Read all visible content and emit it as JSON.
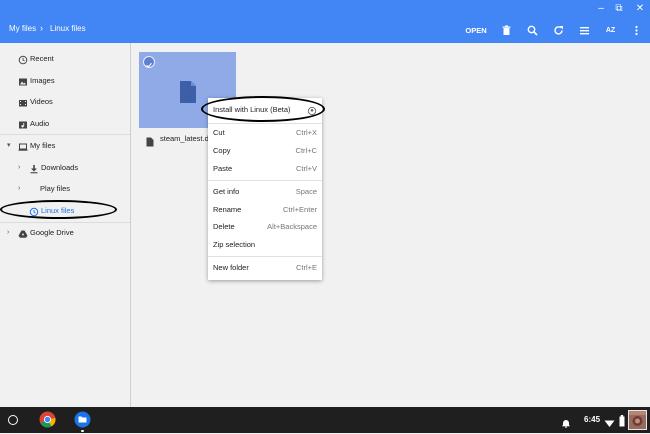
{
  "window": {
    "minimize_glyph": "–",
    "maximize_glyph": "⧉",
    "close_glyph": "✕"
  },
  "toolbar": {
    "breadcrumb": [
      "My files",
      "Linux files"
    ],
    "breadcrumb_separator": "›",
    "open_label": "OPEN",
    "icons": [
      "delete-icon",
      "search-icon",
      "refresh-icon",
      "list-view-icon",
      "sort-az-icon",
      "more-vert-icon"
    ],
    "sort_label": "AZ",
    "accent": "#4285f4"
  },
  "sidebar": {
    "items": [
      {
        "label": "Recent",
        "icon": "clock-icon"
      },
      {
        "label": "Images",
        "icon": "image-icon"
      },
      {
        "label": "Videos",
        "icon": "video-icon"
      },
      {
        "label": "Audio",
        "icon": "audio-icon"
      },
      {
        "label": "My files",
        "icon": "laptop-icon",
        "expanded": true
      },
      {
        "label": "Downloads",
        "icon": "download-icon"
      },
      {
        "label": "Play files",
        "icon": "play-files-icon"
      },
      {
        "label": "Linux files",
        "icon": "linux-icon",
        "selected": true
      },
      {
        "label": "Google Drive",
        "icon": "drive-icon"
      }
    ]
  },
  "content": {
    "file": {
      "name": "steam_latest.de",
      "icon": "file-icon",
      "selected": true
    }
  },
  "context_menu": {
    "items": [
      {
        "label": "Install with Linux (Beta)",
        "shortcut": "",
        "icon": "linux-penguin-icon"
      },
      {
        "label": "Cut",
        "shortcut": "Ctrl+X"
      },
      {
        "label": "Copy",
        "shortcut": "Ctrl+C"
      },
      {
        "label": "Paste",
        "shortcut": "Ctrl+V"
      },
      {
        "label": "Get info",
        "shortcut": "Space"
      },
      {
        "label": "Rename",
        "shortcut": "Ctrl+Enter"
      },
      {
        "label": "Delete",
        "shortcut": "Alt+Backspace"
      },
      {
        "label": "Zip selection",
        "shortcut": ""
      },
      {
        "label": "New folder",
        "shortcut": "Ctrl+E"
      }
    ]
  },
  "shelf": {
    "apps": [
      "chrome-icon",
      "files-app-icon"
    ],
    "time": "6:45",
    "status_icons": [
      "notification-bell-icon",
      "wifi-icon",
      "battery-icon"
    ]
  }
}
